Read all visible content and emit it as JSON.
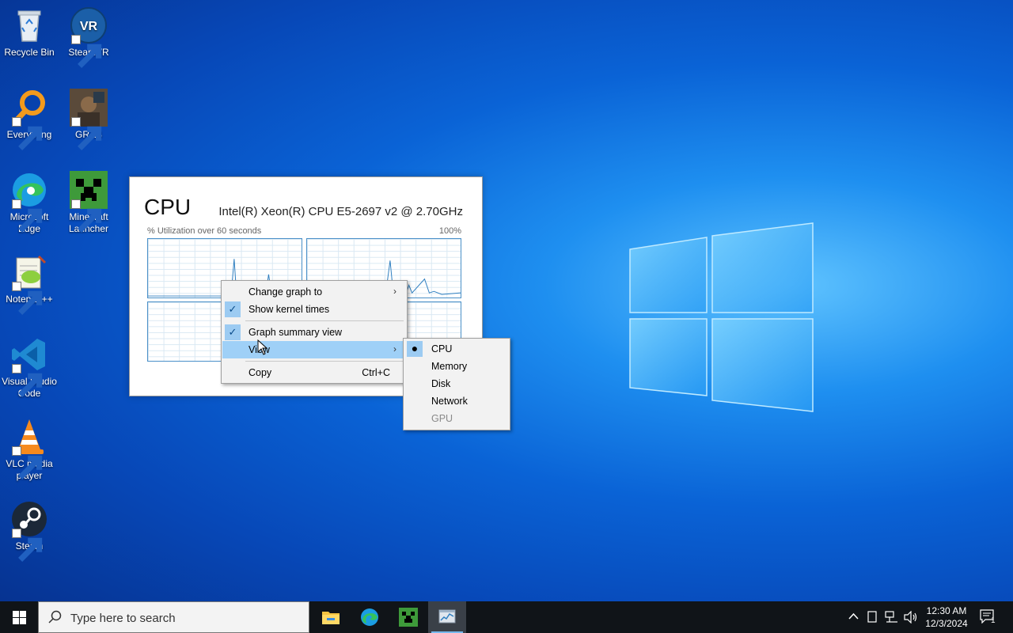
{
  "desktop": {
    "icons": [
      {
        "label": "Recycle Bin"
      },
      {
        "label": "SteamVR"
      },
      {
        "label": "Everything"
      },
      {
        "label": "GRAB"
      },
      {
        "label": "Microsoft Edge"
      },
      {
        "label": "Minecraft Launcher"
      },
      {
        "label": "Notepad++"
      },
      {
        "label": "Visual Studio Code"
      },
      {
        "label": "VLC media player"
      },
      {
        "label": "Steam"
      }
    ],
    "steamvr_text": "VR"
  },
  "cpu_window": {
    "title": "CPU",
    "model": "Intel(R) Xeon(R) CPU E5-2697 v2 @ 2.70GHz",
    "util_label": "% Utilization over 60 seconds",
    "util_max": "100%"
  },
  "context_menu": {
    "items": [
      {
        "label": "Change graph to",
        "has_submenu": true
      },
      {
        "label": "Show kernel times",
        "checked": true
      },
      {
        "label": "Graph summary view",
        "checked": true
      },
      {
        "label": "View",
        "has_submenu": true,
        "highlighted": true
      },
      {
        "label": "Copy",
        "shortcut": "Ctrl+C"
      }
    ],
    "arrow_glyph": "›",
    "check_glyph": "✓"
  },
  "view_submenu": {
    "items": [
      {
        "label": "CPU",
        "selected": true
      },
      {
        "label": "Memory"
      },
      {
        "label": "Disk"
      },
      {
        "label": "Network"
      },
      {
        "label": "GPU",
        "disabled": true
      }
    ],
    "bullet_glyph": "●"
  },
  "taskbar": {
    "search_placeholder": "Type here to search",
    "clock_time": "12:30 AM",
    "clock_date": "12/3/2024",
    "notification_count": "1",
    "apps": [
      "File Explorer",
      "Microsoft Edge",
      "Minecraft Launcher",
      "Task Manager"
    ]
  },
  "colors": {
    "menu_highlight": "#9fd0f7",
    "graph_border": "#4a90c8",
    "graph_line": "#2f7fc0",
    "taskbar_bg": "#101418"
  }
}
